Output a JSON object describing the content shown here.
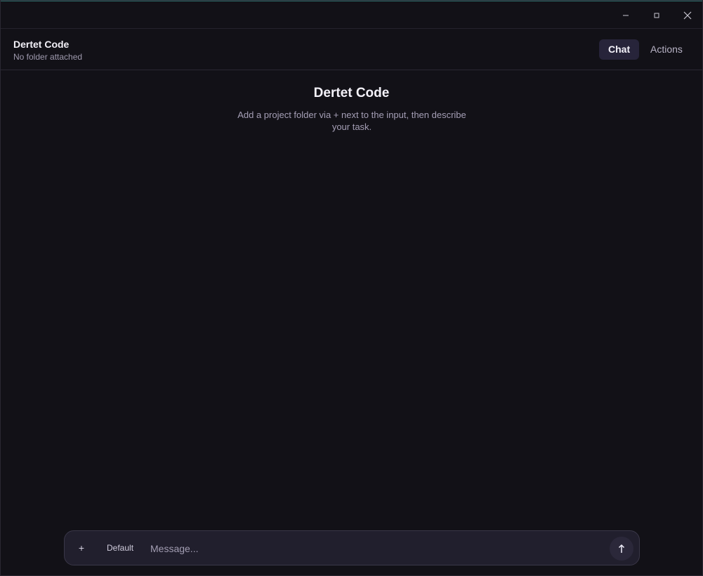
{
  "window": {
    "minimize_icon": "minimize-icon",
    "maximize_icon": "maximize-icon",
    "close_icon": "close-icon"
  },
  "header": {
    "app_name": "Dertet Code",
    "folder_status": "No folder attached",
    "tabs": [
      {
        "label": "Chat",
        "active": true
      },
      {
        "label": "Actions",
        "active": false
      }
    ]
  },
  "main": {
    "welcome_title": "Dertet Code",
    "welcome_text": "Add a project folder via + next to the input, then describe your task."
  },
  "composer": {
    "attach_label": "+",
    "mode_label": "Default",
    "input_value": "",
    "input_placeholder": "Message...",
    "send_icon": "arrow-up-icon"
  },
  "colors": {
    "background": "#121117",
    "panel": "#211f2d",
    "active_tab": "#27243a",
    "muted_text": "#a59fb6"
  }
}
